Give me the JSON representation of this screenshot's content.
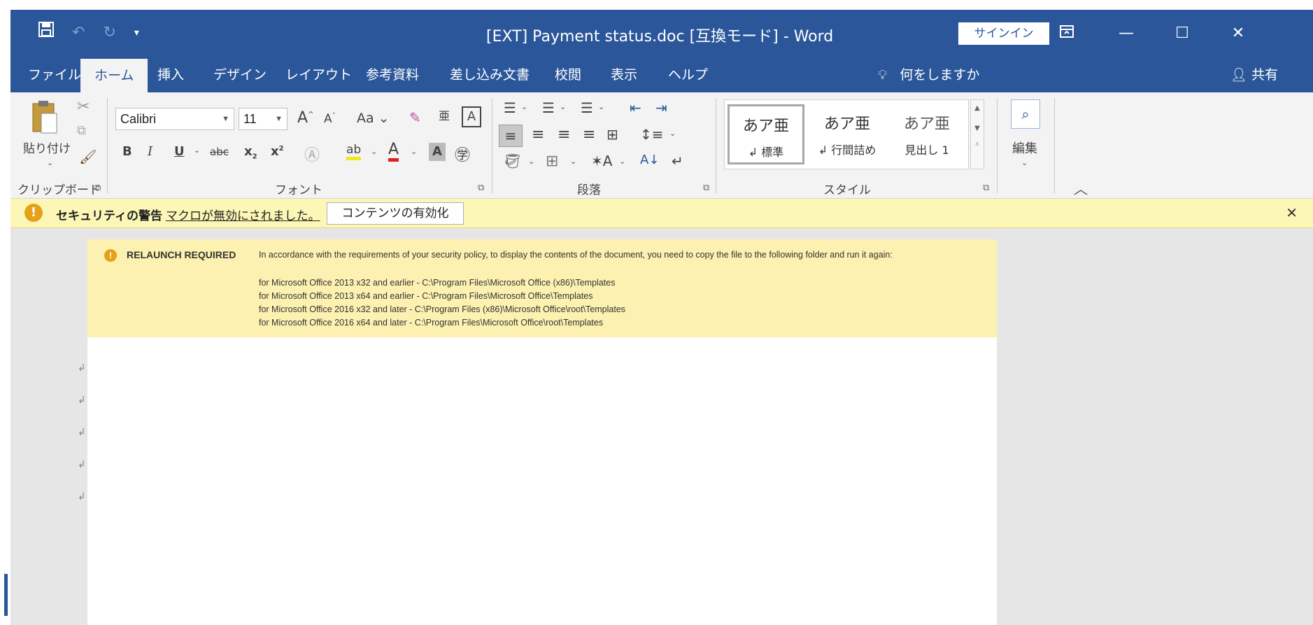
{
  "title_bar": {
    "title": "[EXT] Payment status.doc [互換モード] - Word",
    "signin": "サインイン"
  },
  "qat": {
    "save_icon": "save-icon",
    "undo_icon": "undo-icon",
    "redo_icon": "redo-icon",
    "customize_icon": "qat-customize-icon"
  },
  "window_controls": [
    "ribbon-display-options-icon",
    "minimize-icon",
    "maximize-icon",
    "close-icon"
  ],
  "tabs": [
    "ファイル",
    "ホーム",
    "挿入",
    "デザイン",
    "レイアウト",
    "参考資料",
    "差し込み文書",
    "校閲",
    "表示",
    "ヘルプ"
  ],
  "active_tab": "ホーム",
  "tell_me": "何をしますか",
  "share": "共有",
  "ribbon": {
    "clipboard": {
      "paste": "貼り付け",
      "label": "クリップボード"
    },
    "font": {
      "name": "Calibri",
      "size": "11",
      "case": "Aa",
      "label": "フォント"
    },
    "paragraph": {
      "label": "段落"
    },
    "styles": {
      "label": "スタイル",
      "items": [
        {
          "preview": "あア亜",
          "name": "↲ 標準"
        },
        {
          "preview": "あア亜",
          "name": "↲ 行間詰め"
        },
        {
          "preview": "あア亜",
          "name": "見出し 1"
        }
      ]
    },
    "editing": {
      "label": "編集"
    }
  },
  "security_bar": {
    "title": "セキュリティの警告",
    "message": "マクロが無効にされました。",
    "button": "コンテンツの有効化"
  },
  "document": {
    "banner_title": "RELAUNCH REQUIRED",
    "banner_text": "In accordance with the requirements of your security policy, to display the contents of the document, you need to copy the file to the following folder and run it again:",
    "banner_lines": [
      "for Microsoft Office 2013 x32 and earlier - C:\\Program Files\\Microsoft Office (x86)\\Templates",
      "for Microsoft Office 2013 x64 and earlier - C:\\Program Files\\Microsoft Office\\Templates",
      "for Microsoft Office 2016 x32 and later - C:\\Program Files (x86)\\Microsoft Office\\root\\Templates",
      "for Microsoft Office 2016 x64 and later - C:\\Program Files\\Microsoft Office\\root\\Templates"
    ]
  },
  "colors": {
    "word_blue": "#2b579a",
    "security_bar": "#fcf7b6",
    "banner": "#fcf1b0",
    "warning_icon": "#e5a118"
  }
}
